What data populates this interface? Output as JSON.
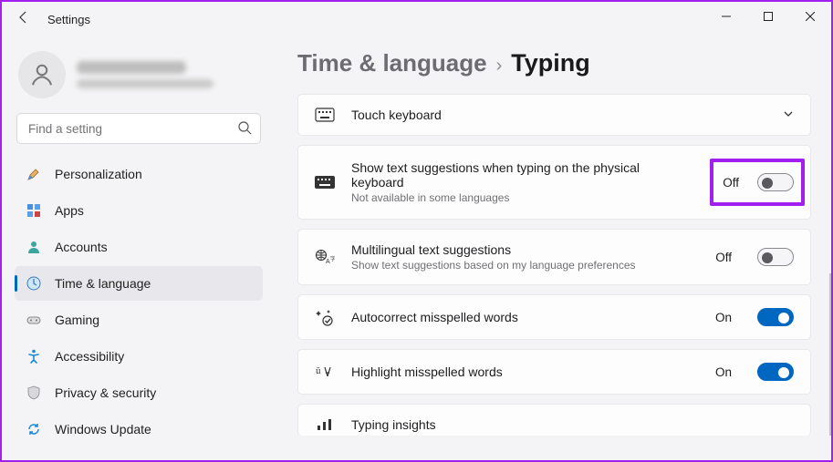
{
  "window": {
    "title": "Settings"
  },
  "search": {
    "placeholder": "Find a setting"
  },
  "nav": {
    "personalization": "Personalization",
    "apps": "Apps",
    "accounts": "Accounts",
    "time_language": "Time & language",
    "gaming": "Gaming",
    "accessibility": "Accessibility",
    "privacy_security": "Privacy & security",
    "windows_update": "Windows Update"
  },
  "breadcrumb": {
    "parent": "Time & language",
    "current": "Typing"
  },
  "cards": {
    "touch_keyboard": {
      "title": "Touch keyboard"
    },
    "physical_suggestions": {
      "title": "Show text suggestions when typing on the physical keyboard",
      "sub": "Not available in some languages",
      "state": "Off"
    },
    "multilingual": {
      "title": "Multilingual text suggestions",
      "sub": "Show text suggestions based on my language preferences",
      "state": "Off"
    },
    "autocorrect": {
      "title": "Autocorrect misspelled words",
      "state": "On"
    },
    "highlight": {
      "title": "Highlight misspelled words",
      "state": "On"
    },
    "insights": {
      "title": "Typing insights"
    }
  }
}
